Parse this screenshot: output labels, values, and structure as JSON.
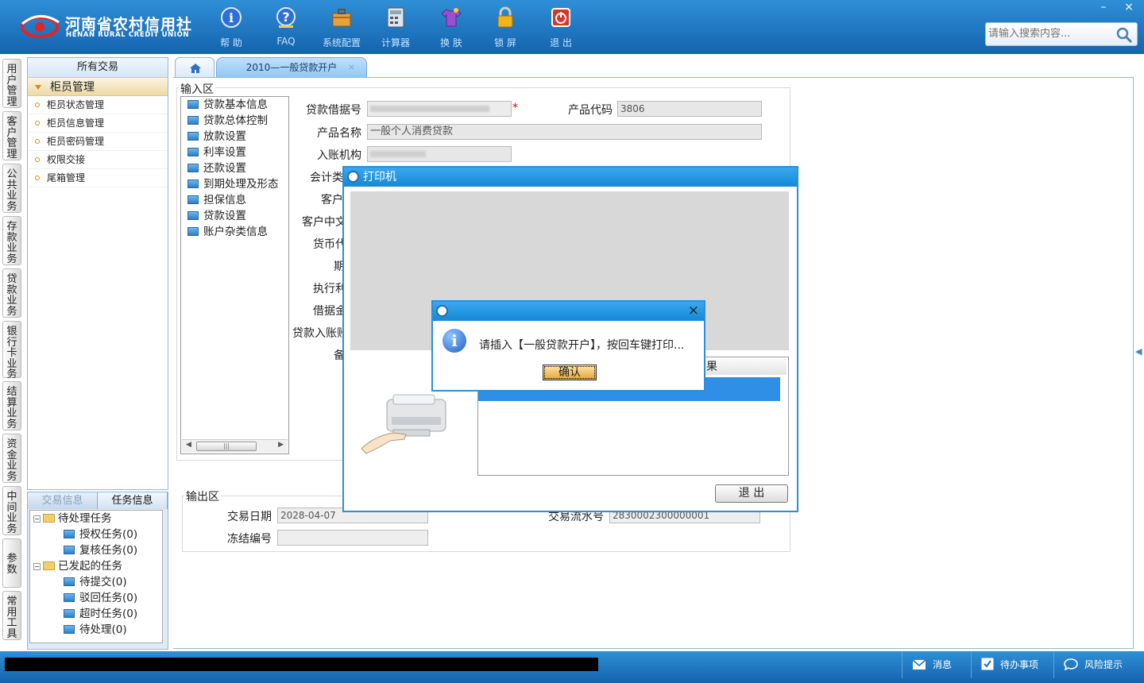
{
  "brand": {
    "name_cn": "河南省农村信用社",
    "name_en": "HENAN RURAL CREDIT UNION"
  },
  "toolbar": [
    {
      "label": "帮 助",
      "icon": "info-icon"
    },
    {
      "label": "FAQ",
      "icon": "question-icon"
    },
    {
      "label": "系统配置",
      "icon": "toolbox-icon"
    },
    {
      "label": "计算器",
      "icon": "calculator-icon"
    },
    {
      "label": "换 肤",
      "icon": "shirt-icon"
    },
    {
      "label": "锁 屏",
      "icon": "lock-icon"
    },
    {
      "label": "退 出",
      "icon": "power-icon"
    }
  ],
  "search": {
    "placeholder": "请输入搜索内容..."
  },
  "vtabs": [
    "用户管理",
    "客户管理",
    "公共业务",
    "存款业务",
    "贷款业务",
    "银行卡业务",
    "结算业务",
    "资金业务",
    "中间业务",
    "参数",
    "常用工具"
  ],
  "leftpanel": {
    "title": "所有交易",
    "group": "柜员管理",
    "items": [
      "柜员状态管理",
      "柜员信息管理",
      "柜员密码管理",
      "权限交接",
      "尾箱管理"
    ]
  },
  "taskpanel": {
    "tabs": [
      "交易信息",
      "任务信息"
    ],
    "pending": "待处理任务",
    "authorize": "授权任务(0)",
    "review": "复核任务(0)",
    "started": "已发起的任务",
    "to_submit": "待提交(0)",
    "rejected": "驳回任务(0)",
    "timeout": "超时任务(0)",
    "to_process": "待处理(0)"
  },
  "tab": {
    "label": "2010—一般贷款开户",
    "close": "×"
  },
  "input_area": {
    "title": "输入区",
    "tree": [
      "贷款基本信息",
      "贷款总体控制",
      "放款设置",
      "利率设置",
      "还款设置",
      "到期处理及形态",
      "担保信息",
      "贷款设置",
      "账户杂类信息"
    ],
    "loan_no_label": "贷款借据号",
    "required_mark": "*",
    "product_code_label": "产品代码",
    "product_code": "3806",
    "product_name_label": "产品名称",
    "product_name": "一般个人消费贷款",
    "entry_org_label": "入账机构",
    "l4": "会计类",
    "l5": "客户",
    "l6": "客户中文",
    "l7": "货币代",
    "l8": "期",
    "l9": "执行利",
    "l10": "借据金",
    "l11": "贷款入账账",
    "l12": "备"
  },
  "output_area": {
    "title": "输出区",
    "date_label": "交易日期",
    "date": "2028-04-07",
    "serial_label": "交易流水号",
    "serial": "2830002300000001",
    "freeze_label": "冻结编号"
  },
  "printer": {
    "title": "打印机",
    "col_result": "果",
    "exit": "退  出"
  },
  "dialog": {
    "message": "请插入【一般贷款开户】，按回车键打印...",
    "ok": "确认",
    "close": "×"
  },
  "statusbar": {
    "messages": "消息",
    "todo": "待办事项",
    "risk": "风险提示"
  },
  "win": {
    "min": "–",
    "close": "×"
  }
}
